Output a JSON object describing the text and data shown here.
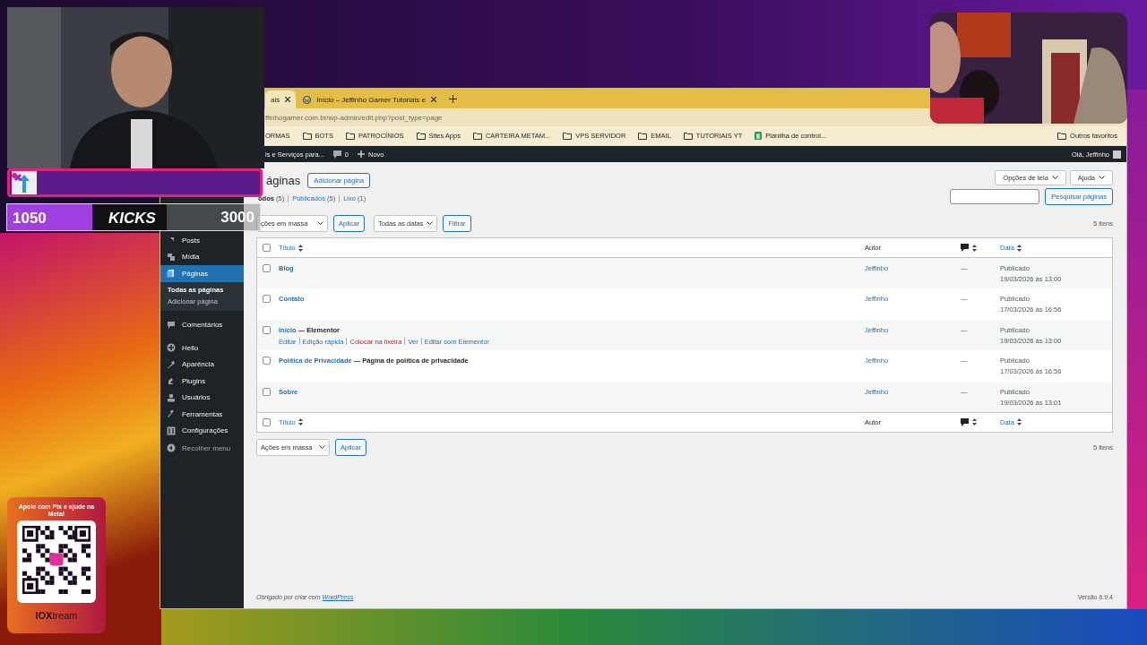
{
  "browser": {
    "tabs": [
      {
        "title": "ais",
        "selected": true
      },
      {
        "title": "Início – Jeffinho Gamer Tutoriais e",
        "selected": false
      }
    ],
    "address": "ffinhogamer.com.br/wp-admin/edit.php?post_type=page",
    "bookmarks": [
      {
        "label": "ORMAS",
        "kind": "plain"
      },
      {
        "label": "BOTS",
        "kind": "folder"
      },
      {
        "label": "PATROCÍNIOS",
        "kind": "folder"
      },
      {
        "label": "Sites Apps",
        "kind": "folder"
      },
      {
        "label": "CARTEIRA METAM...",
        "kind": "folder"
      },
      {
        "label": "VPS SERVIDOR",
        "kind": "folder"
      },
      {
        "label": "EMAIL",
        "kind": "folder"
      },
      {
        "label": "TUTORIAIS YT",
        "kind": "folder"
      },
      {
        "label": "Planilha de control...",
        "kind": "sheet"
      }
    ],
    "other_bookmarks": "Outros favoritos"
  },
  "admin_bar": {
    "site": "is e Serviços para...",
    "comments": "0",
    "new": "Novo",
    "greeting": "Olá, Jeffinho"
  },
  "sidebar": {
    "items": [
      {
        "label": "Posts",
        "kind": "menu",
        "selected": false
      },
      {
        "label": "Mídia",
        "kind": "menu",
        "selected": false
      },
      {
        "label": "Páginas",
        "kind": "menu",
        "selected": true,
        "children": [
          {
            "label": "Todas as páginas",
            "selected": true
          },
          {
            "label": "Adicionar página",
            "selected": false
          }
        ]
      },
      {
        "label": "Comentários",
        "kind": "menu",
        "selected": false
      },
      {
        "label": "Hello",
        "kind": "menu",
        "selected": false
      },
      {
        "label": "Aparência",
        "kind": "menu",
        "selected": false
      },
      {
        "label": "Plugins",
        "kind": "menu",
        "selected": false
      },
      {
        "label": "Usuários",
        "kind": "menu",
        "selected": false
      },
      {
        "label": "Ferramentas",
        "kind": "menu",
        "selected": false
      },
      {
        "label": "Configurações",
        "kind": "menu",
        "selected": false
      },
      {
        "label": "Recolher menu",
        "kind": "collapse",
        "selected": false
      }
    ]
  },
  "page": {
    "title": "áginas",
    "add_button": "Adicionar página",
    "screen_options": "Opções de tela",
    "help": "Ajuda",
    "views": [
      {
        "label": "odos",
        "count": "(5)",
        "selected": true
      },
      {
        "label": "Publicados",
        "count": "(5)",
        "selected": false
      },
      {
        "label": "Lixo",
        "count": "(1)",
        "selected": false
      }
    ],
    "search_button": "Pesquisar páginas",
    "bulk_action": "ções em massa",
    "apply": "Aplicar",
    "date_filter": "Todas as datas",
    "filter": "Filtrar",
    "count": "5 itens",
    "columns": {
      "title": "Título",
      "author": "Autor",
      "date": "Data"
    },
    "footer_columns": {
      "title": "Título",
      "author": "Autor",
      "date": "Data"
    },
    "header_checked": false,
    "rows": [
      {
        "title": "Blog",
        "author": "Jeffinho",
        "comments": "—",
        "status": "Publicado",
        "date": "19/03/2026 às 13:00",
        "checked": false
      },
      {
        "title": "Contato",
        "author": "Jeffinho",
        "comments": "—",
        "status": "Publicado",
        "date": "17/03/2026 às 16:56",
        "checked": false
      },
      {
        "title": "Início",
        "suffix": " — Elementor",
        "author": "Jeffinho",
        "comments": "—",
        "status": "Publicado",
        "date": "19/03/2026 às 13:00",
        "checked": false,
        "actions": [
          {
            "label": "Editar",
            "kind": "link"
          },
          {
            "label": "Edição rápida",
            "kind": "link"
          },
          {
            "label": "Colocar na lixeira",
            "kind": "delete"
          },
          {
            "label": "Ver",
            "kind": "link"
          },
          {
            "label": "Editar com Elementor",
            "kind": "link"
          }
        ]
      },
      {
        "title": "Política de Privacidade",
        "suffix": " — Página de política de privacidade",
        "author": "Jeffinho",
        "comments": "—",
        "status": "Publicado",
        "date": "17/03/2026 às 16:56",
        "checked": false
      },
      {
        "title": "Sobre",
        "author": "Jeffinho",
        "comments": "—",
        "status": "Publicado",
        "date": "19/03/2026 às 13:01",
        "checked": false
      }
    ],
    "bottom_bulk_action": "Ações em massa",
    "bottom_apply": "Aplicar",
    "bottom_count": "5 itens",
    "footer": {
      "text": "Obrigado por criar com ",
      "link": "WordPress",
      "end": ".",
      "version": "Versão 6.9.4"
    }
  },
  "stream": {
    "goal_current": "1050",
    "goal_label": "KICKS",
    "goal_target": "3000",
    "donation_title": "Apoie com Pix e ajude na Meta!",
    "brand": "**IOX**tream"
  }
}
